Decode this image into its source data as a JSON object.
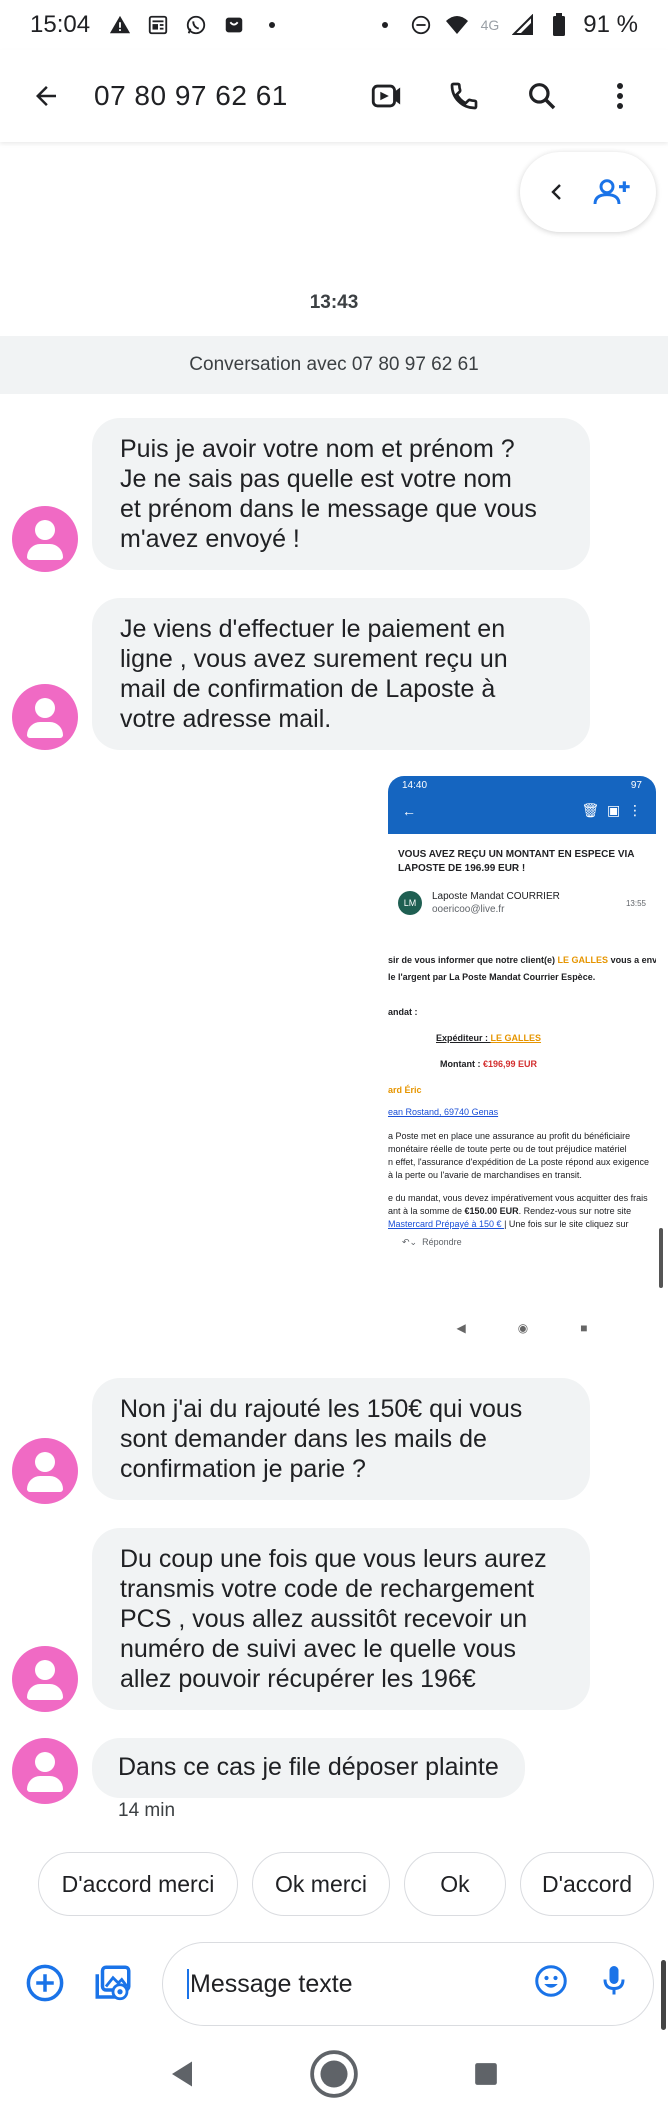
{
  "status_bar": {
    "time": "15:04",
    "network": "4G",
    "battery": "91 %"
  },
  "header": {
    "title": "07 80 97 62 61"
  },
  "conversation": {
    "timestamp": "13:43",
    "banner": "Conversation avec 07 80 97 62 61",
    "messages": [
      {
        "lines": [
          "Puis je avoir votre nom et prénom ?",
          "Je ne sais pas quelle est votre nom",
          "et prénom dans le message que vous",
          "m'avez envoyé !"
        ]
      },
      {
        "lines": [
          "Je viens d'effectuer le paiement en",
          "ligne , vous avez surement reçu un",
          "mail de confirmation de Laposte à",
          "votre adresse mail."
        ]
      },
      {
        "lines": [
          "Non j'ai du rajouté les 150€ qui vous",
          "sont demander dans les mails de",
          "confirmation je parie ?"
        ]
      },
      {
        "lines": [
          "Du coup une fois que vous leurs aurez",
          "transmis votre code de rechargement",
          "PCS , vous allez aussitôt recevoir un",
          "numéro de suivi avec le quelle vous",
          "allez pouvoir récupérer les 196€"
        ]
      },
      {
        "lines": [
          "Dans ce cas je file déposer plainte"
        ]
      }
    ],
    "last_time": "14 min"
  },
  "attachment": {
    "status_time": "14:40",
    "status_battery": "97",
    "subject_line1": "VOUS AVEZ REÇU UN MONTANT EN ESPECE VIA",
    "subject_line2": "LAPOSTE DE 196.99 EUR !",
    "sender_initials": "LM",
    "sender_name": "Laposte Mandat COURRIER",
    "sender_email": "ooericoo@live.fr",
    "sent_time": "13:55",
    "body_line1_a": "sir de vous informer que notre client(e) ",
    "body_line1_b": "LE GALLES",
    "body_line1_c": " vous a envoy",
    "body_line2": "le l'argent par La Poste Mandat Courrier Espèce.",
    "mandat_label": "andat :",
    "expediteur_label": "Expéditeur : ",
    "expediteur_value": "LE GALLES",
    "montant_label": "Montant : ",
    "montant_value": "€196,99 EUR",
    "name_fragment": "ard Éric",
    "address_fragment": "ean Rostand, 69740 Genas",
    "para1": [
      "a Poste met en place une assurance au profit du bénéficiaire",
      "monétaire réelle de toute perte ou de tout préjudice matériel",
      "n effet, l'assurance d'expédition de La poste répond aux exigence",
      "à la perte ou l'avarie de marchandises en transit."
    ],
    "para2_line1": "e du mandat, vous devez impérativement vous acquitter des frais",
    "para2_line2_a": "ant à la somme de ",
    "para2_line2_b": "€150.00 EUR",
    "para2_line2_c": ". Rendez-vous sur notre site",
    "para2_line3_a": "Mastercard Prépayé à 150 € ",
    "para2_line3_b": "| Une fois sur le site cliquez sur",
    "reply_label": "Répondre"
  },
  "suggestions": [
    "D'accord merci",
    "Ok merci",
    "Ok",
    "D'accord"
  ],
  "compose": {
    "placeholder": "Message texte"
  },
  "colors": {
    "avatar": "#f06ac4",
    "accent": "#1a73e8",
    "bubble": "#f1f3f4",
    "email_header": "#1565c0"
  }
}
